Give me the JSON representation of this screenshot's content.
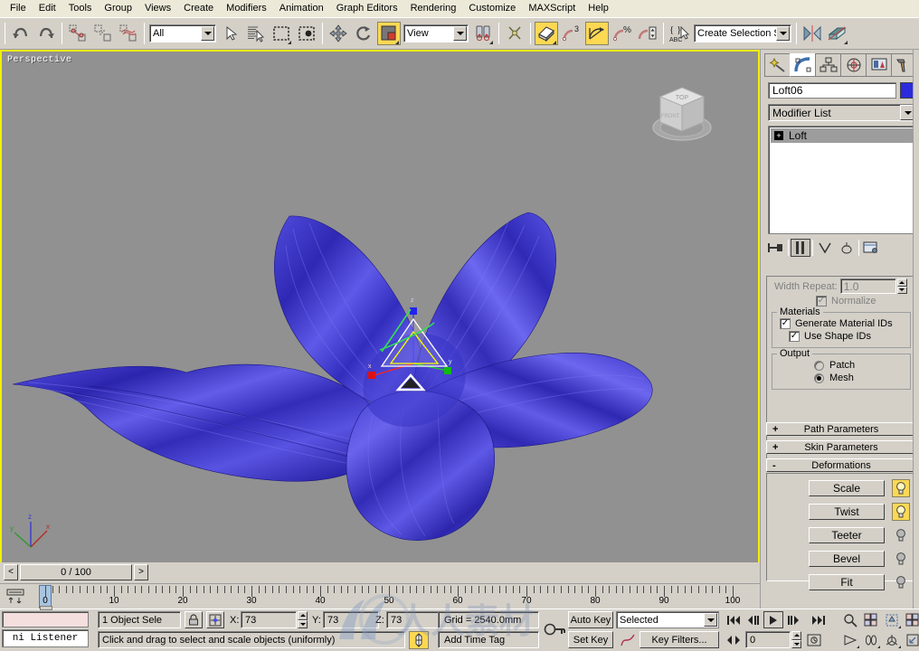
{
  "app": {
    "title": "3ds Max"
  },
  "menu": {
    "items": [
      {
        "label": "File"
      },
      {
        "label": "Edit"
      },
      {
        "label": "Tools"
      },
      {
        "label": "Group"
      },
      {
        "label": "Views"
      },
      {
        "label": "Create"
      },
      {
        "label": "Modifiers"
      },
      {
        "label": "Animation"
      },
      {
        "label": "Graph Editors"
      },
      {
        "label": "Rendering"
      },
      {
        "label": "Customize"
      },
      {
        "label": "MAXScript"
      },
      {
        "label": "Help"
      }
    ]
  },
  "toolbar": {
    "undo": "undo-icon",
    "redo": "redo-icon",
    "select_filter_value": "All",
    "reference_coordinate_value": "View",
    "selection_set_value": "Create Selection Set",
    "buttons": [
      "select-and-link-icon",
      "unlink-selection-icon",
      "bind-to-space-warp-icon",
      "select-object-icon",
      "select-by-name-icon",
      "rectangular-selection-region-icon",
      "window-crossing-icon",
      "select-and-move-icon",
      "select-and-rotate-icon",
      "select-and-uniform-scale-icon",
      "use-pivot-point-center-icon",
      "mirror-icon",
      "align-icon"
    ],
    "snap_toggle": "snaps-toggle-3d",
    "angle_snap": "angle-snap-toggle",
    "percent_snap": "percent-snap-toggle",
    "spinner_snap": "spinner-snap-toggle",
    "named_selection": "named-selection-sets-icon",
    "layer_manager": "layer-manager-icon"
  },
  "viewport": {
    "label": "Perspective",
    "background_color": "#919191",
    "active_border_color": "#f3f000",
    "model": {
      "name": "Loft06",
      "description": "blue five-petal lofted flower",
      "petal_color": "#3a34cc",
      "petal_highlight": "#6f6ae8",
      "petal_shadow": "#1d1a86"
    },
    "gizmo": {
      "x_axis_color": "#ff0000",
      "y_axis_color": "#00cc00",
      "z_axis_color": "#2222ff",
      "active_color": "#ffff00"
    },
    "world_axis": {
      "x_label": "x",
      "y_label": "y",
      "z_label": "z"
    },
    "viewcube_labels": {
      "top": "TOP",
      "front": "FRONT"
    }
  },
  "timeslider": {
    "prev_label": "<",
    "next_label": ">",
    "value": "0 / 100"
  },
  "trackbar": {
    "ticks": [
      {
        "value": 0,
        "label": "0"
      },
      {
        "value": 10,
        "label": "10"
      },
      {
        "value": 20,
        "label": "20"
      },
      {
        "value": 30,
        "label": "30"
      },
      {
        "value": 40,
        "label": "40"
      },
      {
        "value": 50,
        "label": "50"
      },
      {
        "value": 60,
        "label": "60"
      },
      {
        "value": 70,
        "label": "70"
      },
      {
        "value": 80,
        "label": "80"
      },
      {
        "value": 90,
        "label": "90"
      },
      {
        "value": 100,
        "label": "100"
      }
    ],
    "current_frame": 0,
    "range_min": 0,
    "range_max": 100
  },
  "command_panel": {
    "tabs": [
      {
        "name": "create-tab",
        "icon": "star-wand-icon",
        "active": false
      },
      {
        "name": "modify-tab",
        "icon": "curve-bend-icon",
        "active": true
      },
      {
        "name": "hierarchy-tab",
        "icon": "hierarchy-tree-icon",
        "active": false
      },
      {
        "name": "motion-tab",
        "icon": "motion-wheel-icon",
        "active": false
      },
      {
        "name": "display-tab",
        "icon": "display-monitor-icon",
        "active": false
      },
      {
        "name": "utilities-tab",
        "icon": "hammer-icon",
        "active": false
      }
    ],
    "object_name": "Loft06",
    "object_color": "#2b2bdd",
    "modifier_list_label": "Modifier List",
    "modifier_stack": [
      {
        "label": "Loft",
        "expandable": true,
        "selected": true
      }
    ],
    "stack_tools": [
      "pin-stack-icon",
      "show-end-result-icon",
      "make-unique-icon",
      "remove-modifier-icon",
      "configure-modifier-sets-icon"
    ],
    "skin_params": {
      "width_repeat_label": "Width Repeat:",
      "width_repeat_value": "1.0",
      "normalize_label": "Normalize",
      "normalize_checked": true,
      "materials_group": "Materials",
      "generate_material_ids_label": "Generate Material IDs",
      "generate_material_ids_checked": true,
      "use_shape_ids_label": "Use Shape IDs",
      "use_shape_ids_checked": true,
      "output_group": "Output",
      "patch_label": "Patch",
      "mesh_label": "Mesh",
      "output_selected": "Mesh"
    },
    "rollouts": [
      {
        "label": "Path Parameters",
        "state": "+"
      },
      {
        "label": "Skin Parameters",
        "state": "+"
      },
      {
        "label": "Deformations",
        "state": "-"
      }
    ],
    "deformations": [
      {
        "label": "Scale",
        "enabled": true
      },
      {
        "label": "Twist",
        "enabled": true
      },
      {
        "label": "Teeter",
        "enabled": false
      },
      {
        "label": "Bevel",
        "enabled": false
      },
      {
        "label": "Fit",
        "enabled": false
      }
    ]
  },
  "status_bar": {
    "listener_input": "ni Listener",
    "selection_status": "1 Object Sele",
    "lock_icon": "selection-lock-icon",
    "coord_icon": "absolute-relative-transform-icon",
    "x_label": "X:",
    "x_value": "73",
    "y_label": "Y:",
    "y_value": "73",
    "z_label": "Z:",
    "z_value": "73",
    "grid_label": "Grid = 2540.0mm",
    "time_tag": "Add Time Tag",
    "prompt": "Click and drag to select and scale objects (uniformly)",
    "key_mode_icon": "key-mode-toggle-icon",
    "auto_key": "Auto Key",
    "set_key": "Set Key",
    "selection_level": "Selected",
    "key_filters": "Key Filters...",
    "curve_editor_icon": "curve-editor-icon",
    "frame_value": "0",
    "playback": [
      "go-to-start-icon",
      "previous-frame-icon",
      "play-animation-icon",
      "next-frame-icon",
      "go-to-end-icon"
    ],
    "nav_buttons": [
      "zoom-icon",
      "zoom-all-icon",
      "zoom-extents-icon",
      "zoom-extents-all-icon",
      "field-of-view-icon",
      "pan-icon",
      "arc-rotate-icon",
      "maximize-viewport-icon"
    ],
    "key_mode_toggle": "key-mode-toggle"
  },
  "watermark": {
    "text": "人人素材"
  }
}
